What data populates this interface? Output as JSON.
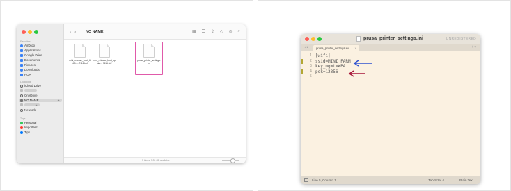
{
  "finder": {
    "title": "NO NAME",
    "sidebar": {
      "favorites_header": "Favorites",
      "favorites": [
        {
          "label": "AirDrop",
          "icon": "airdrop-icon",
          "color": "#3b82f6"
        },
        {
          "label": "Applications",
          "icon": "applications-icon",
          "color": "#3b82f6"
        },
        {
          "label": "Google Drive",
          "icon": "google-drive-icon",
          "color": "#3b82f6"
        },
        {
          "label": "Documents",
          "icon": "document-icon",
          "color": "#3b82f6"
        },
        {
          "label": "Pictures",
          "icon": "pictures-icon",
          "color": "#3b82f6"
        },
        {
          "label": "Downloads",
          "icon": "downloads-icon",
          "color": "#3b82f6"
        },
        {
          "label": "HOA",
          "icon": "folder-icon",
          "color": "#3b82f6"
        }
      ],
      "locations_header": "Locations",
      "locations": [
        {
          "label": "iCloud Drive",
          "icon": "cloud-icon"
        },
        {
          "label": "OneDrive",
          "icon": "cloud-icon"
        },
        {
          "label": "NO NAME",
          "icon": "drive-icon",
          "selected": true
        },
        {
          "label": "Network",
          "icon": "network-icon"
        }
      ],
      "tags_header": "Tags",
      "tags": [
        {
          "label": "Personal",
          "color": "#34c759"
        },
        {
          "label": "Important",
          "color": "#ff3b30"
        },
        {
          "label": "Tips",
          "color": "#007aff"
        }
      ]
    },
    "files": [
      {
        "name": "mini_release_boot_6.4.0-....7116.bbf"
      },
      {
        "name": "mini_release_boot_updat... 7116.bbf"
      },
      {
        "name": "prusa_printer_settings.ini",
        "selected": true
      }
    ],
    "status": "3 items, 7.31 GB available",
    "highlight_color": "#e05aaa"
  },
  "editor": {
    "window_title": "prusa_printer_settings.ini",
    "unregistered": "UNREGISTERED",
    "tab_label": "prusa_printer_settings.ini",
    "lines": [
      {
        "num": "1",
        "text": "[wifi]"
      },
      {
        "num": "2",
        "text": "ssid=MINI FARM"
      },
      {
        "num": "3",
        "text": "key_mgmt=WPA"
      },
      {
        "num": "4",
        "text": "psk=12356"
      },
      {
        "num": "5",
        "text": ""
      }
    ],
    "status_position": "Line 5, Column 1",
    "status_tab": "Tab Size: 4",
    "status_syntax": "Plain Text",
    "arrow_ssid_color": "#2f52d0",
    "arrow_psk_color": "#a8173a"
  }
}
